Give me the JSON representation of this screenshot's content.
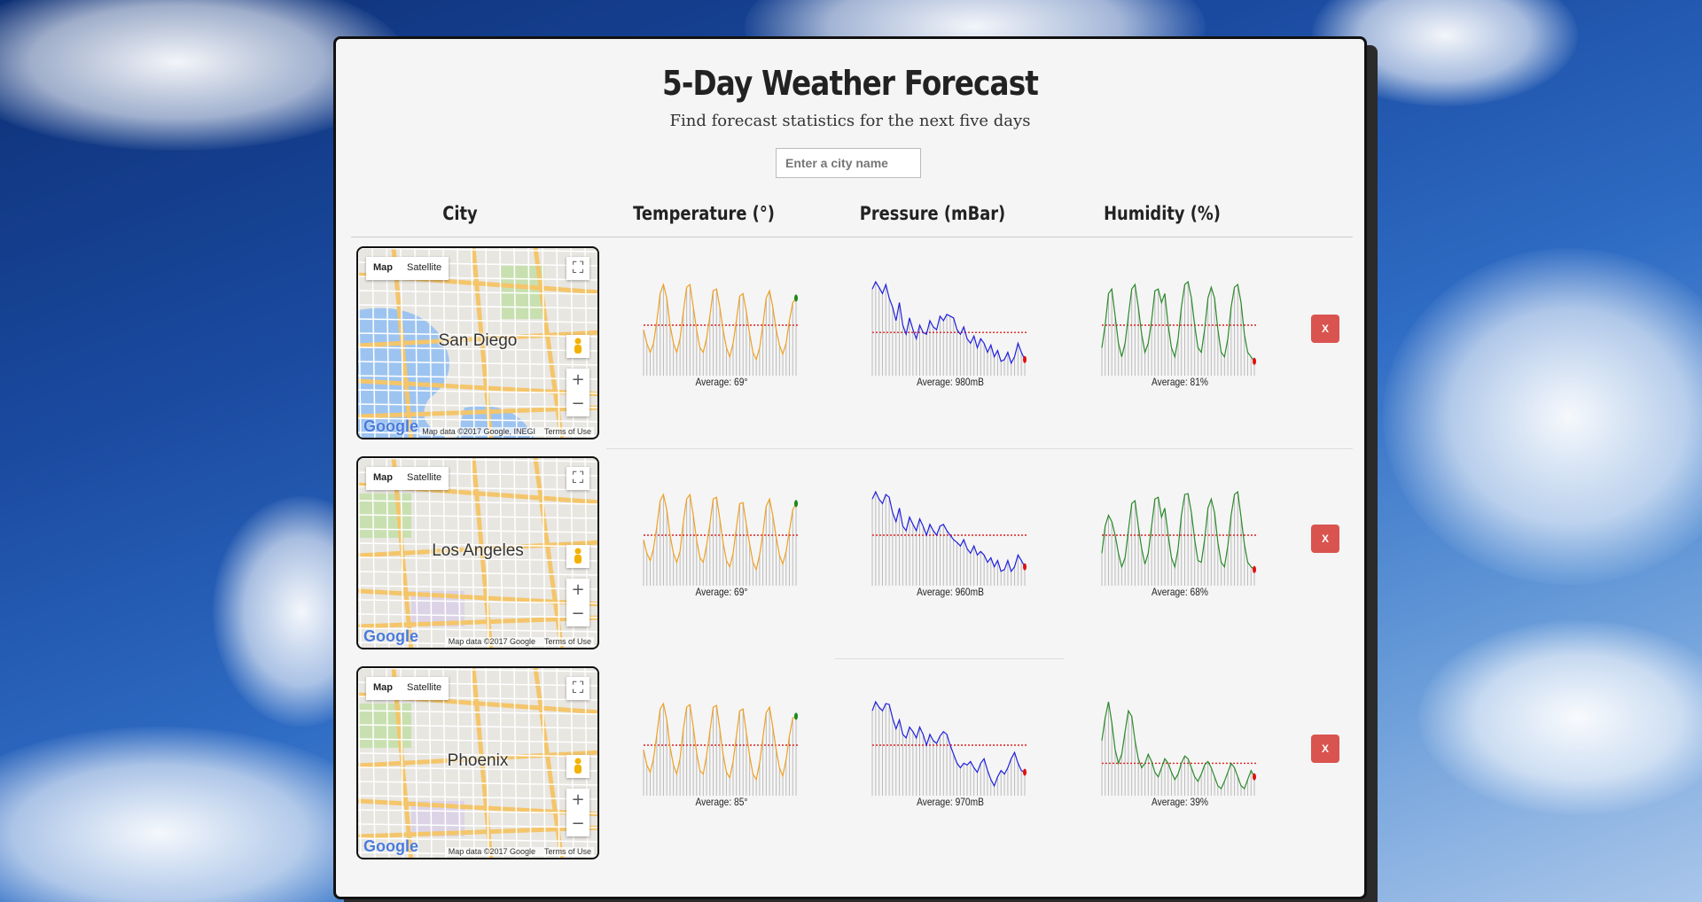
{
  "header": {
    "title": "5-Day Weather Forecast",
    "subtitle": "Find forecast statistics for the next five days",
    "search_placeholder": "Enter a city name"
  },
  "table": {
    "columns": [
      "City",
      "Temperature (°)",
      "Pressure (mBar)",
      "Humidity (%)"
    ]
  },
  "map_controls": {
    "map_label": "Map",
    "satellite_label": "Satellite",
    "fullscreen_icon": "fullscreen-icon",
    "zoom_in": "+",
    "zoom_out": "−",
    "pegman_icon": "pegman-icon",
    "google_logo": "Google",
    "terms": "Terms of Use"
  },
  "rows": [
    {
      "city": "San Diego",
      "map_attribution": "Map data ©2017 Google, INEGI",
      "temperature": {
        "average": "Average: 69°",
        "color": "#f0a020",
        "end_marker": "#1a8a1a",
        "values": [
          0.45,
          0.3,
          0.2,
          0.3,
          0.55,
          0.85,
          0.95,
          0.8,
          0.5,
          0.3,
          0.2,
          0.35,
          0.65,
          0.92,
          0.95,
          0.7,
          0.45,
          0.25,
          0.2,
          0.35,
          0.6,
          0.88,
          0.9,
          0.7,
          0.45,
          0.25,
          0.15,
          0.3,
          0.55,
          0.82,
          0.85,
          0.65,
          0.4,
          0.2,
          0.12,
          0.25,
          0.5,
          0.8,
          0.88,
          0.7,
          0.45,
          0.28,
          0.18,
          0.3,
          0.55,
          0.75,
          0.8
        ],
        "avg_level": 0.5
      },
      "pressure": {
        "average": "Average: 980mB",
        "color": "#2020e0",
        "end_marker": "#e01010",
        "values": [
          0.9,
          0.98,
          0.92,
          0.85,
          0.95,
          0.8,
          0.7,
          0.55,
          0.75,
          0.5,
          0.4,
          0.58,
          0.45,
          0.35,
          0.5,
          0.42,
          0.4,
          0.55,
          0.48,
          0.45,
          0.6,
          0.55,
          0.62,
          0.6,
          0.58,
          0.45,
          0.4,
          0.48,
          0.35,
          0.3,
          0.38,
          0.25,
          0.35,
          0.3,
          0.2,
          0.28,
          0.15,
          0.22,
          0.1,
          0.12,
          0.2,
          0.08,
          0.15,
          0.3,
          0.2,
          0.12
        ],
        "avg_level": 0.42
      },
      "humidity": {
        "average": "Average: 81%",
        "color": "#2a8a2a",
        "end_marker": "#e01010",
        "values": [
          0.25,
          0.5,
          0.85,
          0.9,
          0.6,
          0.3,
          0.15,
          0.3,
          0.6,
          0.9,
          0.95,
          0.7,
          0.4,
          0.2,
          0.3,
          0.55,
          0.88,
          0.9,
          0.75,
          0.85,
          0.5,
          0.25,
          0.15,
          0.35,
          0.7,
          0.95,
          0.98,
          0.8,
          0.5,
          0.25,
          0.2,
          0.45,
          0.8,
          0.92,
          0.8,
          0.45,
          0.2,
          0.15,
          0.35,
          0.7,
          0.92,
          0.95,
          0.75,
          0.4,
          0.2,
          0.15,
          0.1
        ],
        "avg_level": 0.5
      }
    },
    {
      "city": "Los Angeles",
      "map_attribution": "Map data ©2017 Google",
      "temperature": {
        "average": "Average: 69°",
        "color": "#f0a020",
        "end_marker": "#1a8a1a",
        "values": [
          0.45,
          0.3,
          0.22,
          0.35,
          0.6,
          0.88,
          0.95,
          0.78,
          0.5,
          0.3,
          0.2,
          0.32,
          0.65,
          0.9,
          0.95,
          0.72,
          0.45,
          0.25,
          0.2,
          0.38,
          0.62,
          0.9,
          0.92,
          0.68,
          0.42,
          0.22,
          0.15,
          0.3,
          0.58,
          0.85,
          0.86,
          0.62,
          0.4,
          0.2,
          0.12,
          0.28,
          0.52,
          0.82,
          0.9,
          0.72,
          0.48,
          0.28,
          0.18,
          0.32,
          0.55,
          0.78,
          0.85
        ],
        "avg_level": 0.5
      },
      "pressure": {
        "average": "Average: 960mB",
        "color": "#2020e0",
        "end_marker": "#e01010",
        "values": [
          0.9,
          0.98,
          0.9,
          0.85,
          0.95,
          0.92,
          0.75,
          0.65,
          0.8,
          0.6,
          0.55,
          0.7,
          0.62,
          0.55,
          0.68,
          0.6,
          0.5,
          0.62,
          0.55,
          0.5,
          0.6,
          0.62,
          0.55,
          0.5,
          0.45,
          0.42,
          0.38,
          0.45,
          0.35,
          0.3,
          0.38,
          0.28,
          0.32,
          0.28,
          0.2,
          0.25,
          0.15,
          0.22,
          0.1,
          0.12,
          0.22,
          0.1,
          0.15,
          0.28,
          0.22,
          0.15
        ],
        "avg_level": 0.5
      },
      "humidity": {
        "average": "Average: 68%",
        "color": "#2a8a2a",
        "end_marker": "#e01010",
        "values": [
          0.3,
          0.6,
          0.72,
          0.65,
          0.5,
          0.3,
          0.15,
          0.25,
          0.55,
          0.85,
          0.88,
          0.6,
          0.35,
          0.18,
          0.3,
          0.6,
          0.9,
          0.92,
          0.7,
          0.8,
          0.5,
          0.25,
          0.15,
          0.35,
          0.72,
          0.95,
          0.96,
          0.75,
          0.45,
          0.22,
          0.2,
          0.45,
          0.8,
          0.9,
          0.75,
          0.42,
          0.2,
          0.15,
          0.38,
          0.72,
          0.95,
          0.98,
          0.7,
          0.4,
          0.2,
          0.15,
          0.12
        ],
        "avg_level": 0.5
      }
    },
    {
      "city": "Phoenix",
      "map_attribution": "Map data ©2017 Google",
      "temperature": {
        "average": "Average: 85°",
        "color": "#f0a020",
        "end_marker": "#1a8a1a",
        "values": [
          0.45,
          0.28,
          0.2,
          0.35,
          0.62,
          0.9,
          0.96,
          0.78,
          0.48,
          0.28,
          0.18,
          0.35,
          0.68,
          0.92,
          0.95,
          0.7,
          0.42,
          0.22,
          0.18,
          0.38,
          0.65,
          0.92,
          0.94,
          0.68,
          0.4,
          0.2,
          0.14,
          0.32,
          0.6,
          0.88,
          0.9,
          0.64,
          0.38,
          0.18,
          0.12,
          0.3,
          0.58,
          0.86,
          0.92,
          0.7,
          0.45,
          0.25,
          0.16,
          0.34,
          0.6,
          0.8,
          0.82
        ],
        "avg_level": 0.5
      },
      "pressure": {
        "average": "Average: 970mB",
        "color": "#2020e0",
        "end_marker": "#e01010",
        "values": [
          0.88,
          0.98,
          0.92,
          0.88,
          0.96,
          0.95,
          0.8,
          0.68,
          0.78,
          0.62,
          0.58,
          0.7,
          0.65,
          0.58,
          0.7,
          0.62,
          0.5,
          0.62,
          0.55,
          0.52,
          0.6,
          0.65,
          0.62,
          0.5,
          0.4,
          0.3,
          0.25,
          0.3,
          0.28,
          0.32,
          0.25,
          0.2,
          0.3,
          0.35,
          0.22,
          0.12,
          0.05,
          0.15,
          0.22,
          0.18,
          0.25,
          0.35,
          0.42,
          0.3,
          0.22,
          0.2
        ],
        "avg_level": 0.5
      },
      "humidity": {
        "average": "Average: 39%",
        "color": "#2a8a2a",
        "end_marker": "#e01010",
        "values": [
          0.55,
          0.8,
          0.98,
          0.75,
          0.45,
          0.3,
          0.4,
          0.65,
          0.88,
          0.82,
          0.55,
          0.35,
          0.25,
          0.3,
          0.4,
          0.32,
          0.2,
          0.15,
          0.25,
          0.35,
          0.3,
          0.2,
          0.12,
          0.18,
          0.3,
          0.38,
          0.35,
          0.25,
          0.15,
          0.1,
          0.18,
          0.28,
          0.32,
          0.25,
          0.15,
          0.05,
          0.02,
          0.1,
          0.2,
          0.3,
          0.25,
          0.15,
          0.05,
          0.02,
          0.12,
          0.22,
          0.15
        ],
        "avg_level": 0.3
      }
    }
  ],
  "delete_label": "X"
}
